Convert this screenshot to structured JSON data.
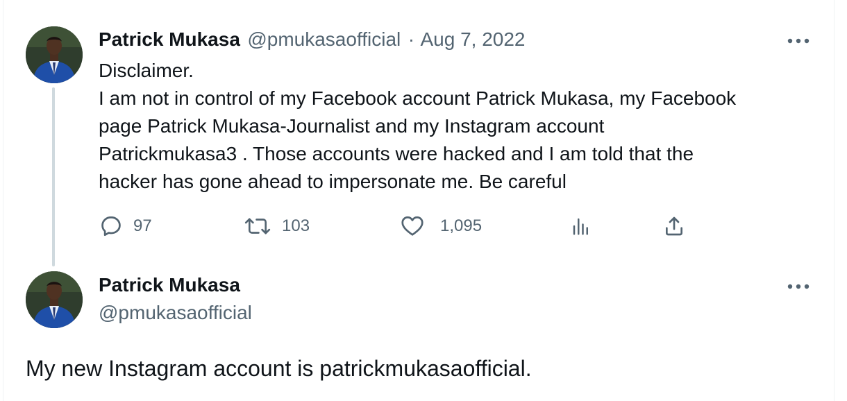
{
  "tweet": {
    "author_name": "Patrick Mukasa",
    "handle": "@pmukasaofficial",
    "separator": "·",
    "date": "Aug 7, 2022",
    "text": "Disclaimer.\nI am not in control of my Facebook account Patrick Mukasa, my Facebook\npage Patrick Mukasa-Journalist and my Instagram account\nPatrickmukasa3 . Those accounts were hacked and I am told that the\nhacker has gone ahead to impersonate me. Be careful",
    "avatar_icon": "profile-photo",
    "more_icon": "more-icon",
    "actions": {
      "reply": {
        "icon": "reply-icon",
        "count": "97"
      },
      "retweet": {
        "icon": "retweet-icon",
        "count": "103"
      },
      "like": {
        "icon": "like-icon",
        "count": "1,095"
      },
      "views": {
        "icon": "views-icon"
      },
      "share": {
        "icon": "share-icon"
      }
    }
  },
  "reply_tweet": {
    "author_name": "Patrick Mukasa",
    "handle": "@pmukasaofficial",
    "text": "My new Instagram account is patrickmukasaofficial.",
    "avatar_icon": "profile-photo",
    "more_icon": "more-icon"
  },
  "colors": {
    "text": "#0f1419",
    "muted": "#536471",
    "thread_line": "#cfd9de",
    "suit_blue": "#1f4fa8"
  }
}
